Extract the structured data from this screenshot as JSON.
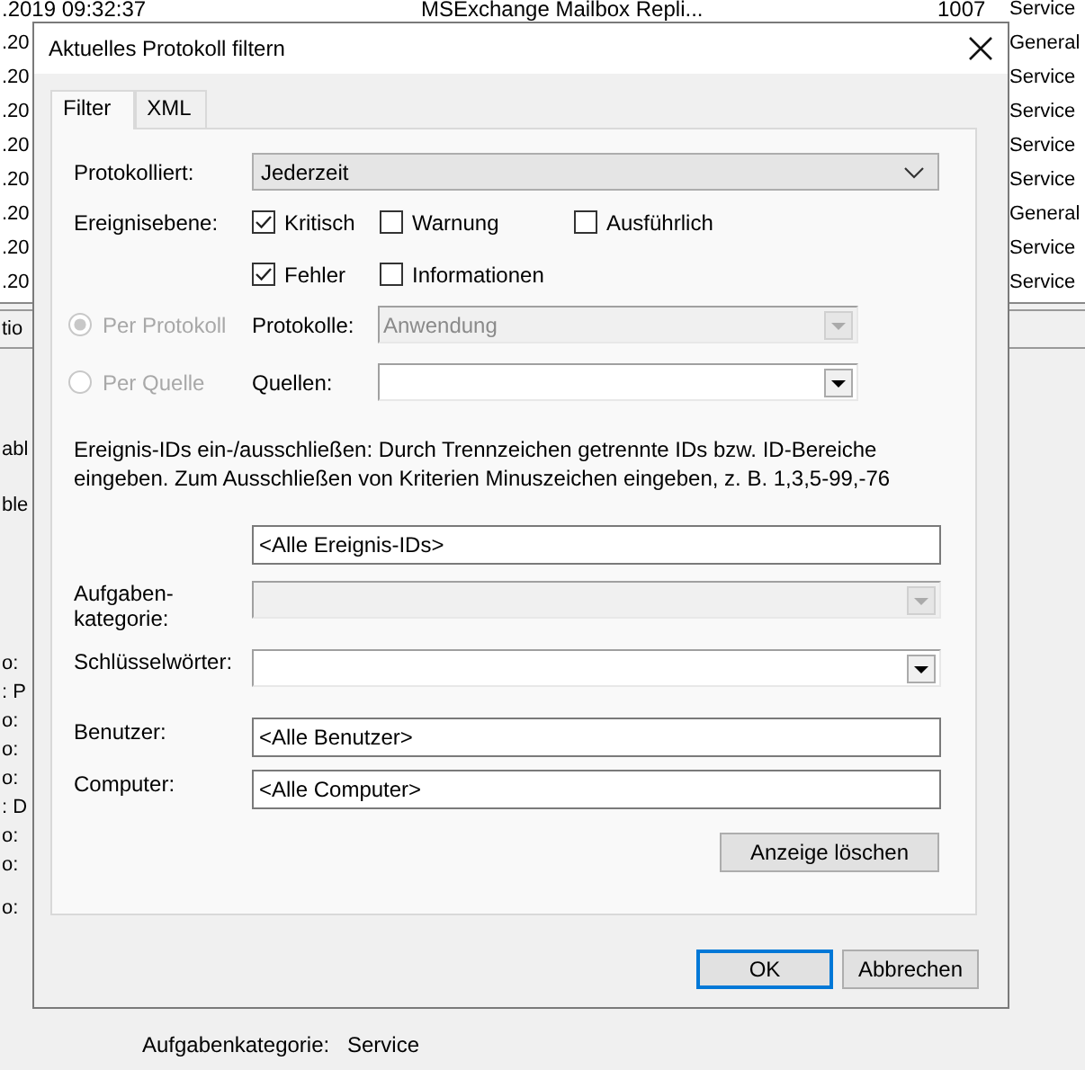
{
  "background": {
    "top_row": {
      "time": ".2019 09:32:37",
      "source": "MSExchange Mailbox Repli...",
      "id": "1007",
      "category": "Service"
    },
    "left_rows": [
      ".20",
      ".20",
      ".20",
      ".20",
      ".20",
      ".20",
      ".20",
      ".20"
    ],
    "right_rows": [
      "General",
      "Service",
      "Service",
      "Service",
      "Service",
      "General",
      "Service",
      "Service"
    ],
    "tab_fragment": "tio",
    "upper_fragments": [
      "abl",
      "ble"
    ],
    "detail_fragments": [
      "o:",
      ": P",
      "o:",
      "o:",
      "o:",
      ": D",
      "o:",
      "o:"
    ],
    "last_fragment": "o:",
    "detail": {
      "label": "Aufgabenkategorie:",
      "value": "Service"
    }
  },
  "dialog": {
    "title": "Aktuelles Protokoll filtern",
    "tabs": [
      {
        "label": "Filter",
        "selected": true
      },
      {
        "label": "XML",
        "selected": false
      }
    ],
    "rows": [
      {
        "kind": "dropdown",
        "label": "Protokolliert:",
        "value": "Jederzeit"
      },
      {
        "kind": "checks",
        "label": "Ereignisebene:",
        "options": [
          {
            "label": "Kritisch",
            "checked": true
          },
          {
            "label": "Warnung",
            "checked": false
          },
          {
            "label": "Ausführlich",
            "checked": false
          },
          {
            "label": "Fehler",
            "checked": true
          },
          {
            "label": "Informationen",
            "checked": false
          }
        ]
      },
      {
        "kind": "source",
        "radio": "Per Protokoll",
        "selected": true,
        "disabled": true,
        "label": "Protokolle:",
        "value": "Anwendung",
        "combo_disabled": true
      },
      {
        "kind": "source",
        "radio": "Per Quelle",
        "selected": false,
        "disabled": true,
        "label": "Quellen:",
        "combo_disabled": false
      },
      {
        "kind": "text",
        "text": "Ereignis-IDs ein-/ausschließen: Durch Trennzeichen getrennte IDs bzw. ID-Bereiche eingeben. Zum Ausschließen von Kriterien Minuszeichen eingeben, z. B. 1,3,5-99,-76"
      },
      {
        "kind": "input",
        "value": "<Alle Ereignis-IDs>"
      },
      {
        "kind": "combo",
        "label": "Aufgaben-kategorie:",
        "disabled": true
      },
      {
        "kind": "combo",
        "label": "Schlüsselwörter:",
        "disabled": false
      },
      {
        "kind": "input",
        "label": "Benutzer:",
        "value": "<Alle Benutzer>"
      },
      {
        "kind": "input",
        "label": "Computer:",
        "value": "<Alle Computer>"
      },
      {
        "kind": "button",
        "label": "Anzeige löschen"
      }
    ],
    "buttons": [
      {
        "label": "OK",
        "default": true
      },
      {
        "label": "Abbrechen",
        "default": false
      }
    ]
  }
}
